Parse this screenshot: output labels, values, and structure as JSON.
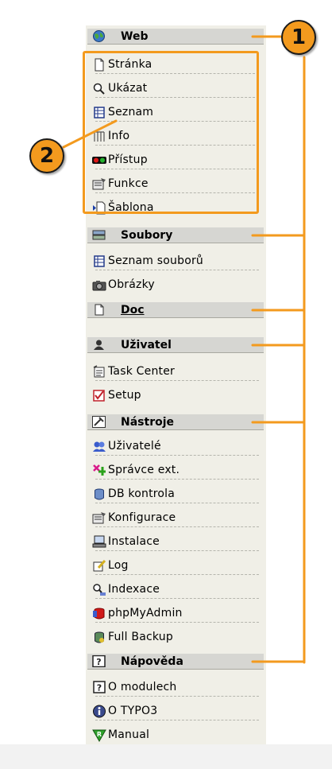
{
  "headers": {
    "web": "Web",
    "soubory": "Soubory",
    "doc": "Doc",
    "uzivatel": "Uživatel",
    "nastroje": "Nástroje",
    "napoveda": "Nápověda"
  },
  "items": {
    "web": [
      "Stránka",
      "Ukázat",
      "Seznam",
      "Info",
      "Přístup",
      "Funkce",
      "Šablona"
    ],
    "soubory": [
      "Seznam souborů",
      "Obrázky"
    ],
    "uzivatel": [
      "Task Center",
      "Setup"
    ],
    "nastroje": [
      "Uživatelé",
      "Správce ext.",
      "DB kontrola",
      "Konfigurace",
      "Instalace",
      "Log",
      "Indexace",
      "phpMyAdmin",
      "Full Backup"
    ],
    "napoveda": [
      "O modulech",
      "O TYPO3",
      "Manual"
    ]
  },
  "callouts": {
    "one": "1",
    "two": "2"
  },
  "colors": {
    "accent": "#f39a1e",
    "panel": "#f0efe7",
    "header": "#d6d6d2"
  }
}
